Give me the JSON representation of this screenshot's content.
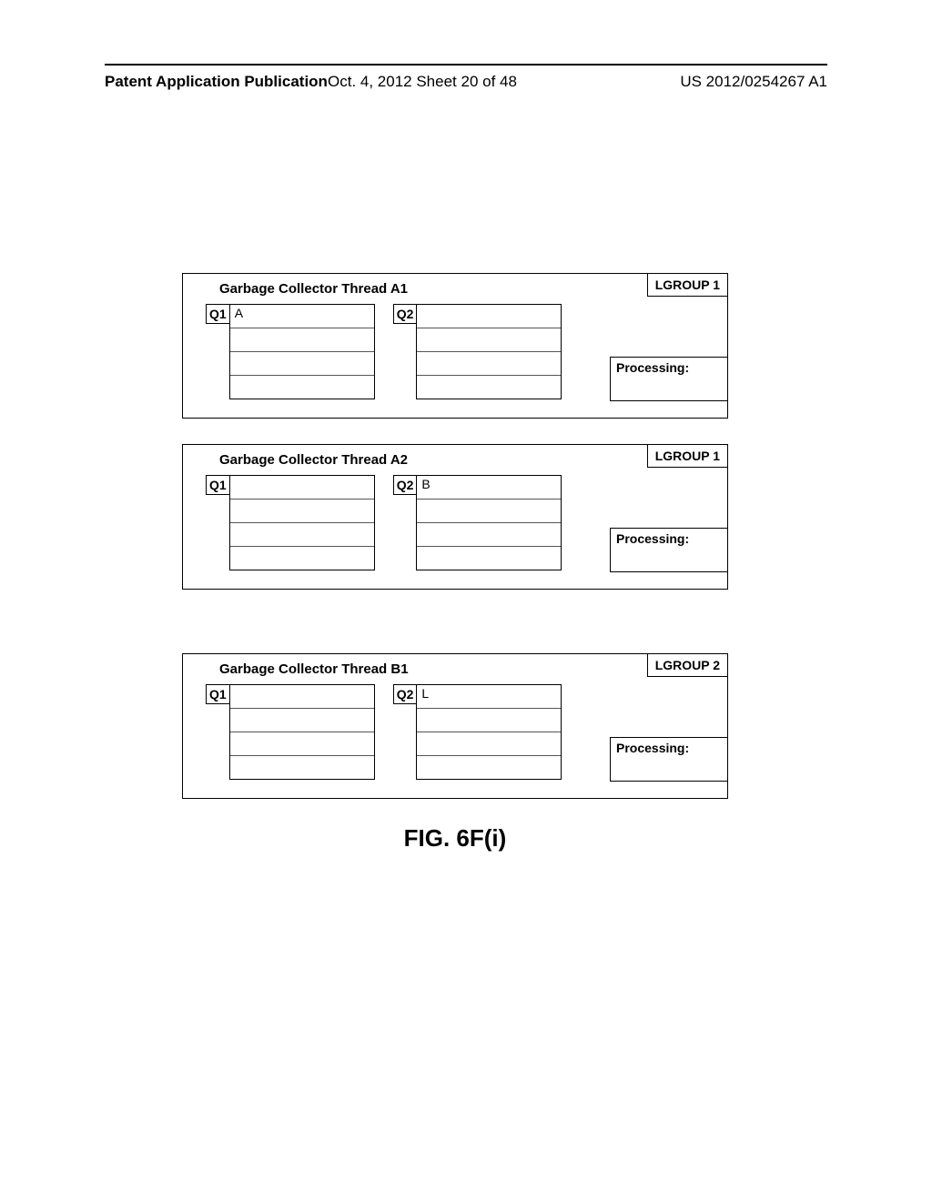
{
  "header": {
    "left": "Patent Application Publication",
    "mid": "Oct. 4, 2012   Sheet 20 of 48",
    "right": "US 2012/0254267 A1"
  },
  "panels": [
    {
      "title": "Garbage Collector Thread A1",
      "lgroup": "LGROUP 1",
      "q1_label": "Q1",
      "q1_slots": [
        "A",
        "",
        "",
        ""
      ],
      "q2_label": "Q2",
      "q2_slots": [
        "",
        "",
        "",
        ""
      ],
      "processing": "Processing:"
    },
    {
      "title": "Garbage Collector Thread A2",
      "lgroup": "LGROUP 1",
      "q1_label": "Q1",
      "q1_slots": [
        "",
        "",
        "",
        ""
      ],
      "q2_label": "Q2",
      "q2_slots": [
        "B",
        "",
        "",
        ""
      ],
      "processing": "Processing:"
    },
    {
      "title": "Garbage Collector Thread B1",
      "lgroup": "LGROUP 2",
      "q1_label": "Q1",
      "q1_slots": [
        "",
        "",
        "",
        ""
      ],
      "q2_label": "Q2",
      "q2_slots": [
        "L",
        "",
        "",
        ""
      ],
      "processing": "Processing:"
    }
  ],
  "figure_label": "FIG. 6F(i)"
}
